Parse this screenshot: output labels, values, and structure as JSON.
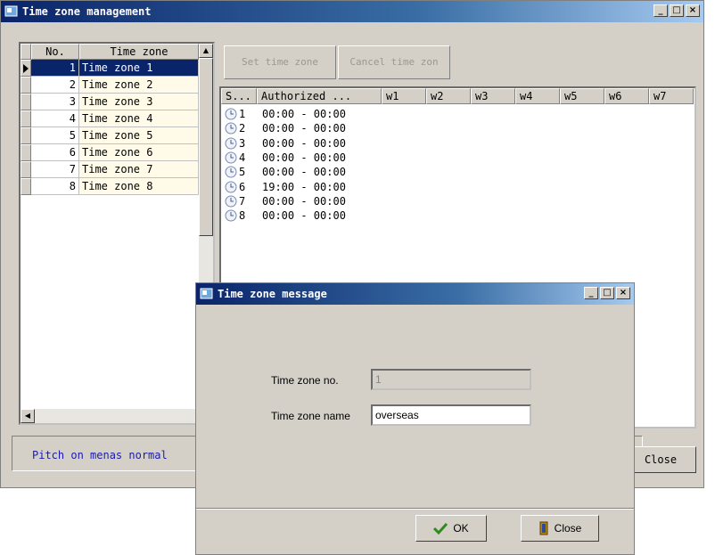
{
  "main_window": {
    "title": "Time zone management",
    "controls": {
      "minimize": "_",
      "maximize": "□",
      "close": "×"
    }
  },
  "zone_list": {
    "columns": [
      "No.",
      "Time zone"
    ],
    "rows": [
      {
        "no": "1",
        "name": "Time zone 1",
        "selected": true
      },
      {
        "no": "2",
        "name": "Time zone 2"
      },
      {
        "no": "3",
        "name": "Time zone 3"
      },
      {
        "no": "4",
        "name": "Time zone 4"
      },
      {
        "no": "5",
        "name": "Time zone 5"
      },
      {
        "no": "6",
        "name": "Time zone 6"
      },
      {
        "no": "7",
        "name": "Time zone 7"
      },
      {
        "no": "8",
        "name": "Time zone 8"
      }
    ]
  },
  "toolbar": {
    "set_label": "Set time zone",
    "cancel_label": "Cancel time zon"
  },
  "segments": {
    "columns": [
      "S...",
      "Authorized ...",
      "w1",
      "w2",
      "w3",
      "w4",
      "w5",
      "w6",
      "w7"
    ],
    "rows": [
      {
        "id": "1",
        "time": "00:00 - 00:00"
      },
      {
        "id": "2",
        "time": "00:00 - 00:00"
      },
      {
        "id": "3",
        "time": "00:00 - 00:00"
      },
      {
        "id": "4",
        "time": "00:00 - 00:00"
      },
      {
        "id": "5",
        "time": "00:00 - 00:00"
      },
      {
        "id": "6",
        "time": "19:00 - 00:00"
      },
      {
        "id": "7",
        "time": "00:00 - 00:00"
      },
      {
        "id": "8",
        "time": "00:00 - 00:00"
      }
    ]
  },
  "status_text": "Pitch on menas normal",
  "close_label": "Close",
  "dialog": {
    "title": "Time zone message",
    "no_label": "Time zone no.",
    "no_value": "1",
    "name_label": "Time zone name",
    "name_value": "overseas",
    "ok_label": "OK",
    "close_label": "Close"
  }
}
